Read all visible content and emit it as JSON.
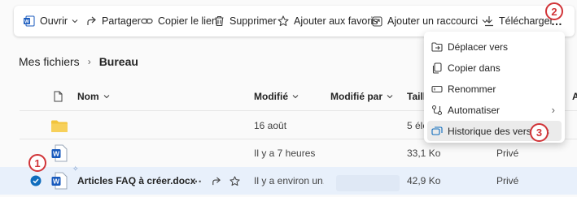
{
  "toolbar": {
    "open": "Ouvrir",
    "share": "Partager",
    "copy_link": "Copier le lien",
    "delete": "Supprimer",
    "favorites": "Ajouter aux favoris",
    "shortcut": "Ajouter un raccourci",
    "download": "Télécharger",
    "more": "…"
  },
  "breadcrumb": {
    "root": "Mes fichiers",
    "current": "Bureau"
  },
  "table": {
    "columns": {
      "name": "Nom",
      "modified": "Modifié",
      "modified_by": "Modifié par",
      "size": "Taill",
      "sharing": "A"
    },
    "rows": [
      {
        "name": "",
        "modified": "16 août",
        "modified_by": "",
        "size": "5 élé",
        "sharing": ""
      },
      {
        "name": "",
        "modified": "Il y a 7 heures",
        "modified_by": "",
        "size": "33,1 Ko",
        "sharing": "Privé"
      },
      {
        "name": "Articles FAQ à créer.docx",
        "modified": "Il y a environ un...",
        "modified_by": "",
        "size": "42,9 Ko",
        "sharing": "Privé"
      }
    ]
  },
  "context_menu": {
    "items": [
      "Déplacer vers",
      "Copier dans",
      "Renommer",
      "Automatiser",
      "Historique des versions"
    ]
  },
  "annotations": {
    "one": "1",
    "two": "2",
    "three": "3"
  },
  "colors": {
    "accent": "#0f6cbd",
    "word_blue": "#185abd",
    "folder": "#f2c43c",
    "annotation_red": "#d13438",
    "selected_row": "#e8f0fb"
  }
}
